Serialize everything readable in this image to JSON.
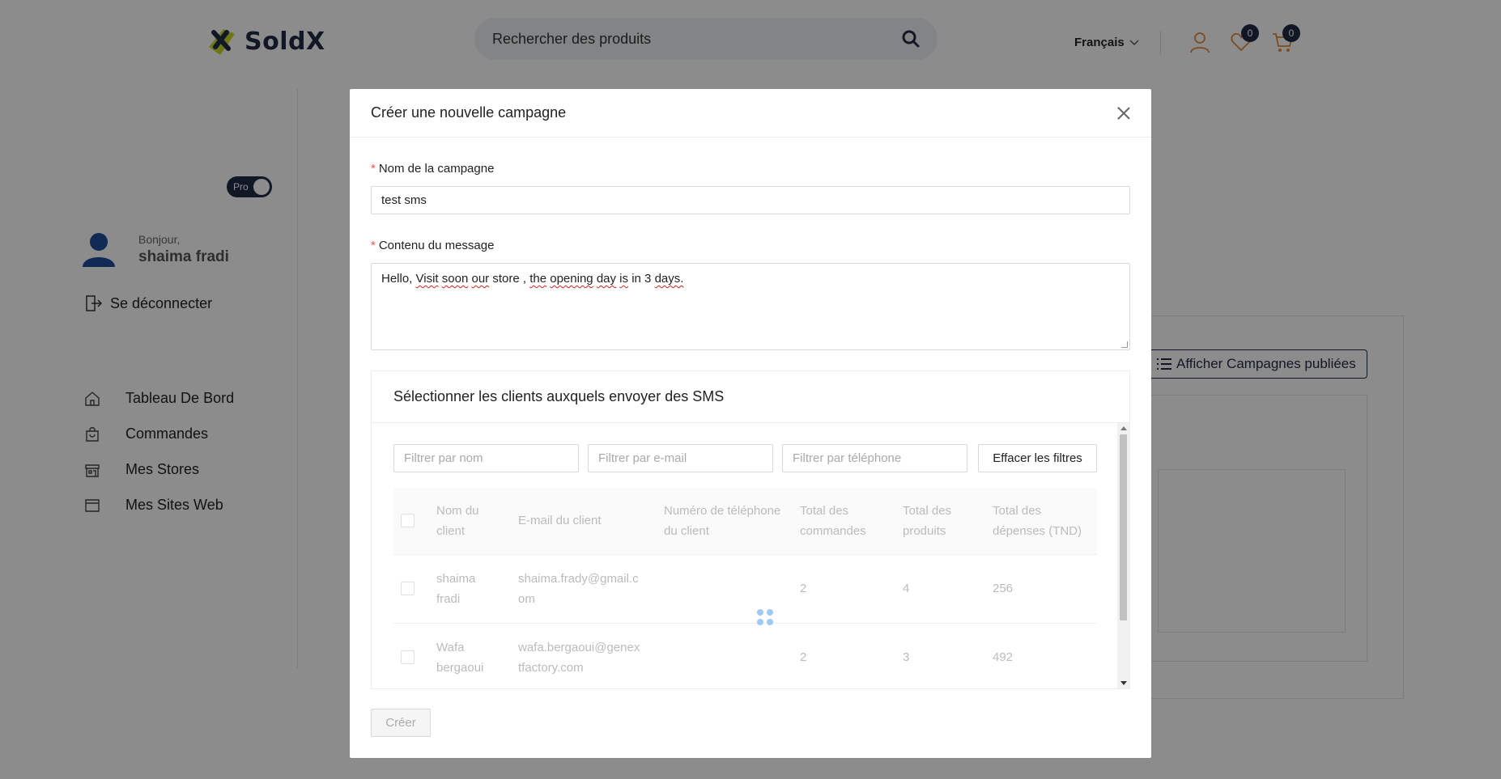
{
  "header": {
    "brand": "SoldX",
    "search_placeholder": "Rechercher des produits",
    "language": "Français",
    "wishlist_count": "0",
    "cart_count": "0"
  },
  "sidebar": {
    "pro_label": "Pro",
    "greeting": "Bonjour,",
    "user_name": "shaima fradi",
    "logout_label": "Se déconnecter",
    "items": [
      {
        "label": "Tableau De Bord",
        "icon": "home-icon"
      },
      {
        "label": "Commandes",
        "icon": "shopping-bag-icon"
      },
      {
        "label": "Mes Stores",
        "icon": "store-icon"
      },
      {
        "label": "Mes Sites Web",
        "icon": "browser-icon"
      }
    ]
  },
  "background": {
    "published_button": "Afficher Campagnes publiées"
  },
  "modal": {
    "title": "Créer une nouvelle campagne",
    "name_label": "Nom de la campagne",
    "name_value": "test sms",
    "message_label": "Contenu du message",
    "message_words": [
      "Hello,",
      "Visit",
      "soon",
      "our",
      "store",
      ",",
      "the",
      "opening",
      "day",
      "is",
      "in",
      "3",
      "days."
    ],
    "clients_card_title": "Sélectionner les clients auxquels envoyer des SMS",
    "filters": {
      "name_placeholder": "Filtrer par nom",
      "email_placeholder": "Filtrer par e-mail",
      "phone_placeholder": "Filtrer par téléphone",
      "clear_label": "Effacer les filtres"
    },
    "table": {
      "headers": [
        "Nom du client",
        "E-mail du client",
        "Numéro de téléphone du client",
        "Total des commandes",
        "Total des produits",
        "Total des dépenses (TND)"
      ],
      "rows": [
        {
          "name": "shaima fradi",
          "email": "shaima.frady@gmail.com",
          "phone": "",
          "orders": "2",
          "products": "4",
          "spend": "256"
        },
        {
          "name": "Wafa bergaoui",
          "email": "wafa.bergaoui@genextfactory.com",
          "phone": "",
          "orders": "2",
          "products": "3",
          "spend": "492"
        }
      ]
    },
    "create_label": "Créer"
  },
  "colors": {
    "brand_navy": "#1f2a44",
    "brand_accent": "#c9d928",
    "icon_orange": "#e08a3c",
    "required": "#ff4d4f",
    "spinner": "#9ec9f5"
  }
}
